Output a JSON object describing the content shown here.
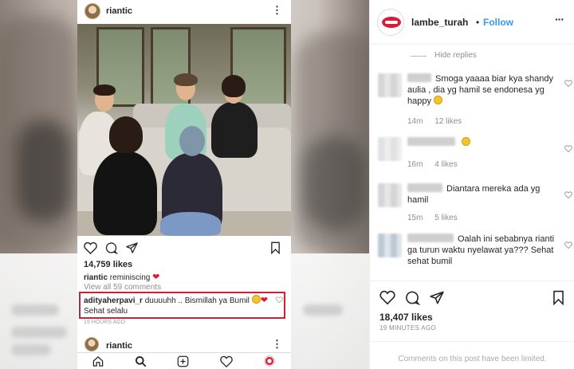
{
  "phone": {
    "username": "riantic",
    "likes": "14,759 likes",
    "caption": {
      "user": "riantic",
      "text": "reminiscing"
    },
    "view_all": "View all 59 comments",
    "highlighted_comment": {
      "user": "adityaherpavi_r",
      "text": "duuuuhh .. Bismillah ya Bumil",
      "text2": "Sehat selalu"
    },
    "time": "19 hours ago",
    "next_post_username": "riantic"
  },
  "sidebar": {
    "username": "lambe_turah",
    "separator": "•",
    "follow_label": "Follow",
    "hide_replies": "Hide replies",
    "comments": [
      {
        "text": "Smoga yaaaa biar kya shandy aulia , dia yg hamil se endonesa yg happy",
        "time": "14m",
        "likes": "12 likes"
      },
      {
        "text": "",
        "time": "16m",
        "likes": "4 likes"
      },
      {
        "text": "Diantara mereka ada yg hamil",
        "time": "15m",
        "likes": "5 likes"
      },
      {
        "text": "Oalah ini sebabnya rianti ga turun waktu nyelawat ya??? Sehat sehat bumil",
        "time": "",
        "likes": ""
      }
    ],
    "likes": "18,407 likes",
    "time": "19 MINUTES AGO",
    "footer": "Comments on this post have been limited."
  },
  "colors": {
    "follow": "#3897f0",
    "highlight_box": "#c0283a",
    "heart": "#e0183a"
  }
}
